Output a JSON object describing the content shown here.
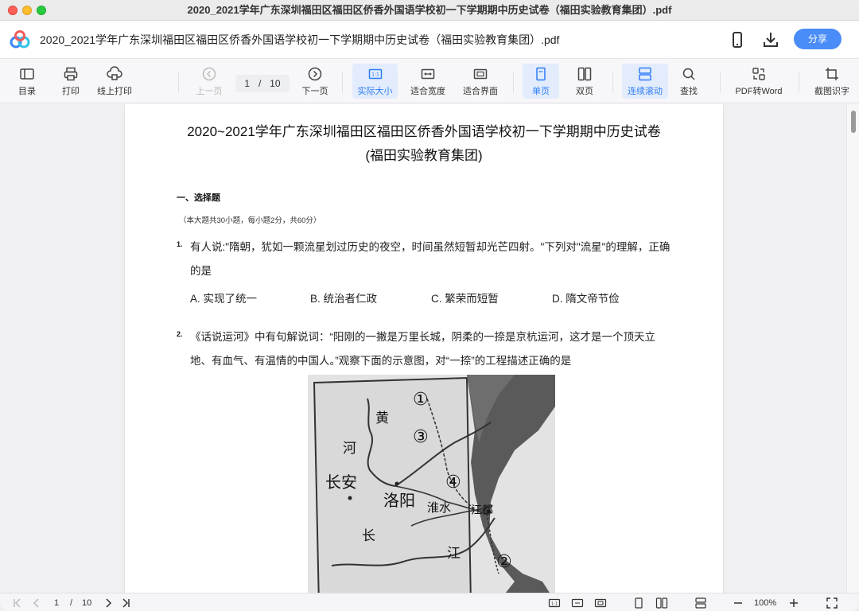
{
  "window": {
    "title": "2020_2021学年广东深圳福田区福田区侨香外国语学校初一下学期期中历史试卷（福田实验教育集团）.pdf"
  },
  "appbar": {
    "doc_name": "2020_2021学年广东深圳福田区福田区侨香外国语学校初一下学期期中历史试卷（福田实验教育集团）.pdf",
    "share_label": "分享",
    "icons": [
      "app-logo-icon",
      "mobile-icon",
      "download-icon"
    ]
  },
  "toolbar": {
    "contents": "目录",
    "print": "打印",
    "online_print": "线上打印",
    "prev_page": "上一页",
    "current_page": "1",
    "page_sep": "/",
    "total_pages": "10",
    "next_page": "下一页",
    "actual_size": "实际大小",
    "fit_width": "适合宽度",
    "fit_page": "适合界面",
    "single_page": "单页",
    "double_page": "双页",
    "continuous_scroll": "连续滚动",
    "find": "查找",
    "pdf_to_word": "PDF转Word",
    "ocr": "截图识字"
  },
  "document": {
    "title_line1": "2020~2021学年广东深圳福田区福田区侨香外国语学校初一下学期期中历史试卷",
    "title_line2": "(福田实验教育集团)",
    "section_heading": "一、选择题",
    "section_note": "（本大题共30小题，每小题2分，共60分）",
    "questions": [
      {
        "number": "1.",
        "line1": "有人说:\"隋朝，犹如一颗流星划过历史的夜空，时间虽然短暂却光芒四射。\"下列对\"流星\"的理解，正确",
        "line2": "的是",
        "options": [
          "A. 实现了统一",
          "B. 统治者仁政",
          "C. 繁荣而短暂",
          "D. 隋文帝节俭"
        ]
      },
      {
        "number": "2.",
        "line1": "《话说运河》中有句解说词：“阳刚的一撇是万里长城，阴柔的一捺是京杭运河，这才是一个顶天立",
        "line2": "地、有血气、有温情的中国人。”观察下面的示意图，对“一捺”的工程描述正确的是"
      }
    ],
    "map_labels": {
      "huang": "黄",
      "he": "河",
      "changan": "长安",
      "luoyang": "洛阳",
      "huaishui": "淮水",
      "jiangdu": "江都",
      "chang": "长",
      "jiang": "江",
      "m1": "①",
      "m2": "②",
      "m3": "③",
      "m4": "④"
    }
  },
  "statusbar": {
    "current_page": "1",
    "page_sep": "/",
    "total_pages": "10",
    "zoom": "100%"
  },
  "colors": {
    "accent": "#2f7cf6",
    "share_button": "#4a8df8",
    "active_bg": "#e2ecfc"
  }
}
